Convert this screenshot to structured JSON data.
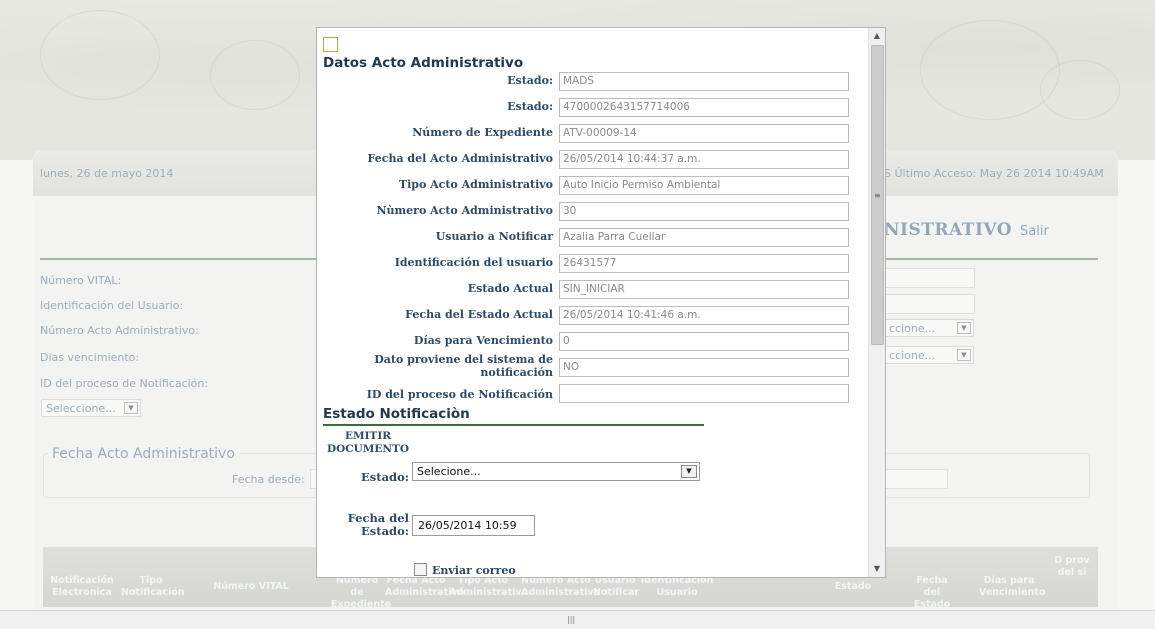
{
  "background": {
    "date": "lunes, 26 de mayo 2014",
    "last_access": "S Último Acceso: May 26 2014 10:49AM",
    "title_fragment": "NISTRATIVO",
    "salir": "Salir",
    "labels": {
      "numero_vital": "Número VITAL:",
      "identificacion_usuario": "Identificación del Usuario:",
      "numero_acto": "Número Acto Administrativo:",
      "dias_vencimiento": "Dias vencimiento:",
      "id_proceso": "ID del proceso de Notificación:"
    },
    "select_left": "Seleccione...",
    "select_right_1": "ccione...",
    "select_right_2": "ccione...",
    "fieldset_legend": "Fecha Acto Administrativo",
    "fecha_desde": "Fecha desde:",
    "table_headers": [
      "Notificación Electronica",
      "Tipo Notificación",
      "Número VITAL",
      "Número de Expediente",
      "Fecha Acto Administrativo",
      "Tipo Acto Administrativo",
      "Número Acto Administrativo",
      "Usuario Notificar",
      "Identificación Usuario",
      "Estado",
      "Fecha del Estado",
      "Días para Vencimiento",
      "D prov del si"
    ]
  },
  "modal": {
    "section_title": "Datos Acto Administrativo",
    "fields": [
      {
        "label": "Estado:",
        "value": "MADS"
      },
      {
        "label": "Estado:",
        "value": "4700002643157714006"
      },
      {
        "label": "Número de Expediente",
        "value": "ATV-00009-14"
      },
      {
        "label": "Fecha del Acto Administrativo",
        "value": "26/05/2014 10:44:37 a.m."
      },
      {
        "label": "Tipo Acto Administrativo",
        "value": "Auto Inicio Permiso Ambiental"
      },
      {
        "label": "Nùmero Acto Administrativo",
        "value": "30"
      },
      {
        "label": "Usuario a Notificar",
        "value": "Azalia  Parra Cuellar"
      },
      {
        "label": "Identificación del usuario",
        "value": "26431577"
      },
      {
        "label": "Estado Actual",
        "value": "SIN_INICIAR"
      },
      {
        "label": "Fecha del Estado Actual",
        "value": "26/05/2014 10:41:46 a.m."
      },
      {
        "label": "Días para Vencimiento",
        "value": "0"
      },
      {
        "label": "Dato proviene del sistema de notificación",
        "value": "NO"
      },
      {
        "label": "ID del proceso de Notificación",
        "value": ""
      }
    ],
    "estado_section_title": "Estado Notificaciòn",
    "emitir_documento": "EMITIR DOCUMENTO",
    "estado_label": "Estado:",
    "estado_select_value": "Selecione...",
    "fecha_estado_label": "Fecha del Estado:",
    "fecha_estado_value": "26/05/2014 10:59",
    "enviar_correo_label": "Enviar correo"
  }
}
